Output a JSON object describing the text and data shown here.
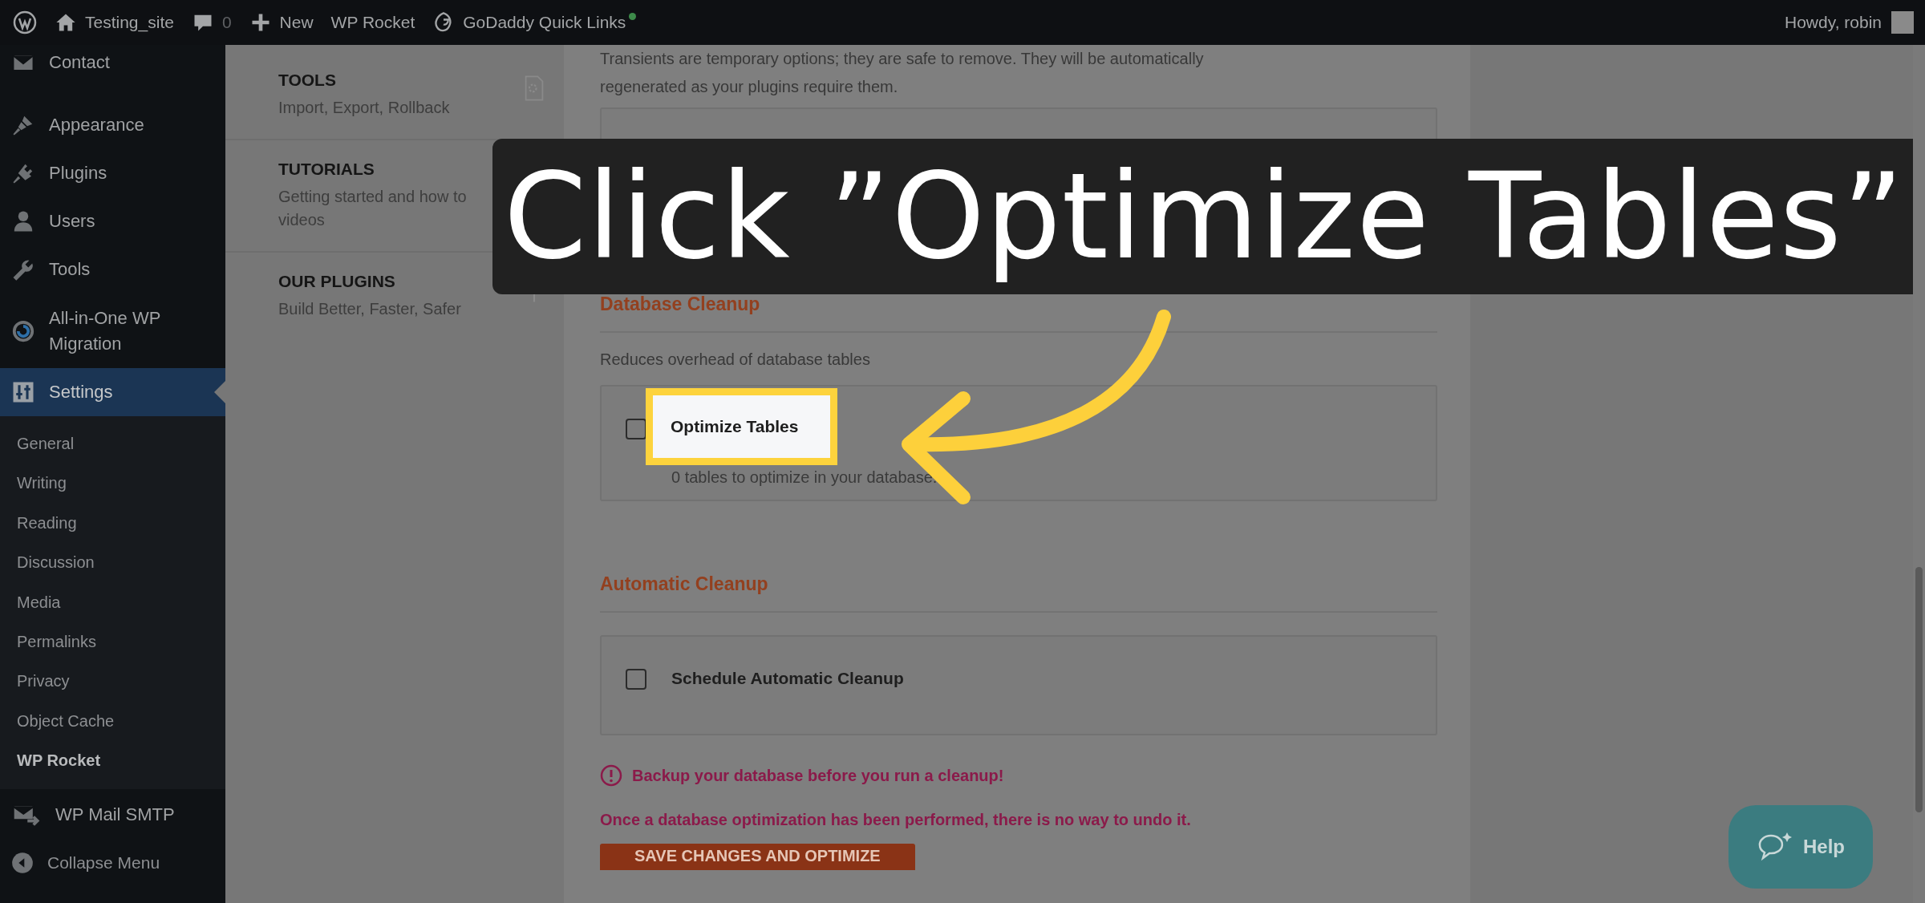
{
  "top_bar": {
    "site_name": "Testing_site",
    "comments_count": "0",
    "new_label": "New",
    "plugin_link": "WP Rocket",
    "quick_links": "GoDaddy Quick Links",
    "greeting": "Howdy, robin"
  },
  "sidebar": {
    "items": [
      {
        "label": "Contact",
        "selected": false
      },
      {
        "label": "Appearance",
        "selected": false
      },
      {
        "label": "Plugins",
        "selected": false
      },
      {
        "label": "Users",
        "selected": false
      },
      {
        "label": "Tools",
        "selected": false
      },
      {
        "label": "All-in-One WP Migration",
        "selected": false
      },
      {
        "label": "Settings",
        "selected": true,
        "children": [
          {
            "label": "General",
            "selected": false
          },
          {
            "label": "Writing",
            "selected": false
          },
          {
            "label": "Reading",
            "selected": false
          },
          {
            "label": "Discussion",
            "selected": false
          },
          {
            "label": "Media",
            "selected": false
          },
          {
            "label": "Permalinks",
            "selected": false
          },
          {
            "label": "Privacy",
            "selected": false
          },
          {
            "label": "Object Cache",
            "selected": false
          },
          {
            "label": "WP Rocket",
            "selected": true
          }
        ]
      },
      {
        "label": "WP Mail SMTP",
        "selected": false
      }
    ],
    "collapse_label": "Collapse Menu"
  },
  "rocket_nav": [
    {
      "title": "TOOLS",
      "subtitle": "Import, Export, Rollback"
    },
    {
      "title": "TUTORIALS",
      "subtitle": "Getting started and how to videos"
    },
    {
      "title": "OUR PLUGINS",
      "subtitle": "Build Better, Faster, Safer"
    }
  ],
  "content": {
    "intro_lines": [
      "Transients are temporary options; they are safe to remove. They will be automatically",
      "regenerated as your plugins require them."
    ],
    "sections": [
      {
        "title": "Database Cleanup",
        "description": "Reduces overhead of database tables",
        "option": {
          "label": "Optimize Tables",
          "description": "0 tables to optimize in your database.",
          "checked": false,
          "highlighted": true
        }
      },
      {
        "title": "Automatic Cleanup",
        "option": {
          "label": "Schedule Automatic Cleanup",
          "checked": false,
          "highlighted": false
        }
      }
    ],
    "warning": "Backup your database before you run a cleanup!",
    "note": "Once a database optimization has been performed, there is no way to undo it.",
    "save_button": "SAVE CHANGES AND OPTIMIZE"
  },
  "callout": {
    "text": "Click ”Optimize Tables”"
  },
  "help_button": {
    "label": "Help"
  }
}
